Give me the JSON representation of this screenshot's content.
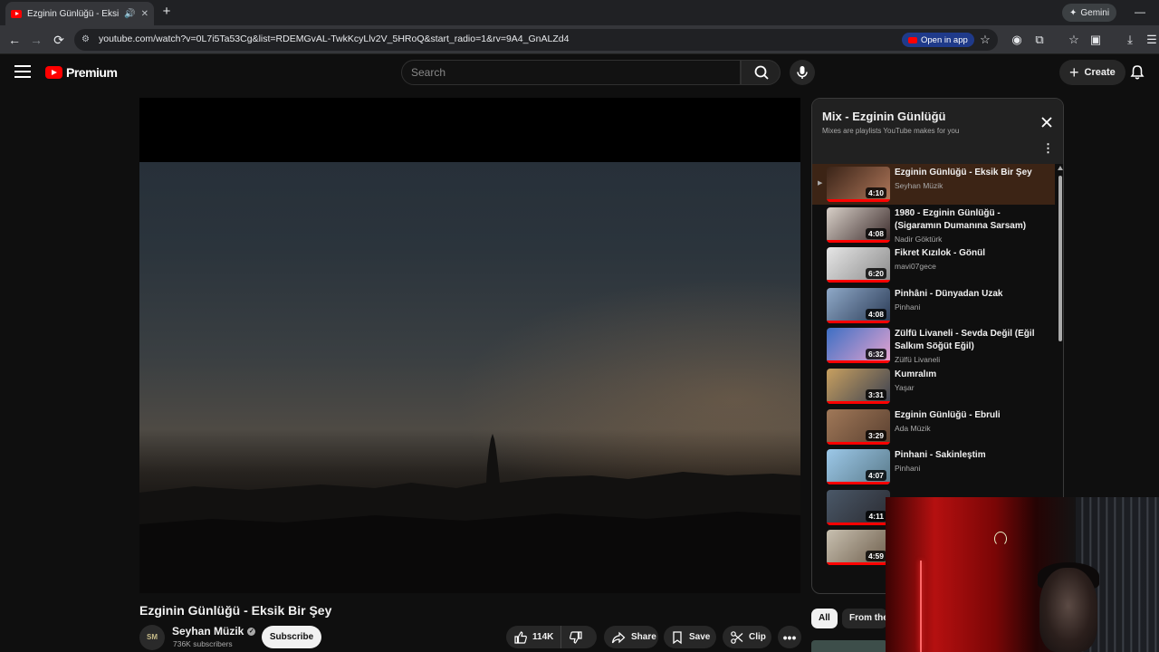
{
  "browser": {
    "tab_title": "Ezginin Günlüğü - Eksik Bir Şey",
    "url": "youtube.com/watch?v=0L7i5Ta53Cg&list=RDEMGvAL-TwkKcyLlv2V_5HRoQ&start_radio=1&rv=9A4_GnALZd4",
    "open_in_app": "Open in app",
    "gemini": "Gemini"
  },
  "header": {
    "logo": "Premium",
    "search_placeholder": "Search",
    "create": "Create"
  },
  "video": {
    "title": "Ezginin Günlüğü - Eksik Bir Şey",
    "watermark": "SM",
    "channel": "Seyhan Müzik",
    "channel_avatar": "SM",
    "subscribers": "736K subscribers",
    "subscribe": "Subscribe",
    "likes": "114K",
    "share": "Share",
    "save": "Save",
    "clip": "Clip"
  },
  "playlist": {
    "title": "Mix - Ezginin Günlüğü",
    "subtitle": "Mixes are playlists YouTube makes for you",
    "items": [
      {
        "title": "Ezginin Günlüğü - Eksik Bir Şey",
        "channel": "Seyhan Müzik",
        "duration": "4:10",
        "active": true,
        "thumb": [
          "#3a2418",
          "#b0775a"
        ]
      },
      {
        "title": "1980 - Ezginin Günlüğü - (Sigaramın Dumanına Sarsam)",
        "channel": "Nadir Göktürk",
        "duration": "4:08",
        "active": false,
        "thumb": [
          "#d8d0c8",
          "#3a2a2a"
        ]
      },
      {
        "title": "Fikret Kızılok - Gönül",
        "channel": "mavi07gece",
        "duration": "6:20",
        "active": false,
        "thumb": [
          "#e6e6e6",
          "#8a8a8a"
        ]
      },
      {
        "title": "Pinhâni - Dünyadan Uzak",
        "channel": "Pinhani",
        "duration": "4:08",
        "active": false,
        "thumb": [
          "#8fa9c8",
          "#2a3a55"
        ]
      },
      {
        "title": "Zülfü Livaneli - Sevda Değil (Eğil Salkım Söğüt Eğil)",
        "channel": "Zülfü Livaneli",
        "duration": "6:32",
        "active": false,
        "thumb": [
          "#3d6fc4",
          "#e8a4d0"
        ]
      },
      {
        "title": "Kumralım",
        "channel": "Yaşar",
        "duration": "3:31",
        "active": false,
        "thumb": [
          "#c8a060",
          "#3a4050"
        ]
      },
      {
        "title": "Ezginin Günlüğü - Ebruli",
        "channel": "Ada Müzik",
        "duration": "3:29",
        "active": false,
        "thumb": [
          "#a07858",
          "#5a4030"
        ]
      },
      {
        "title": "Pinhani - Sakinleştim",
        "channel": "Pinhani",
        "duration": "4:07",
        "active": false,
        "thumb": [
          "#9cc8e8",
          "#5a7a8a"
        ]
      },
      {
        "title": "",
        "channel": "",
        "duration": "4:11",
        "active": false,
        "thumb": [
          "#4a5868",
          "#2a2a30"
        ]
      },
      {
        "title": "",
        "channel": "",
        "duration": "4:59",
        "active": false,
        "thumb": [
          "#c8c0b0",
          "#6a5a48"
        ]
      }
    ]
  },
  "chips": {
    "all": "All",
    "from": "From the series"
  },
  "colors": {
    "accent_red": "#ff0000",
    "background": "#0f0f0f",
    "active_row": "#3c2415"
  }
}
